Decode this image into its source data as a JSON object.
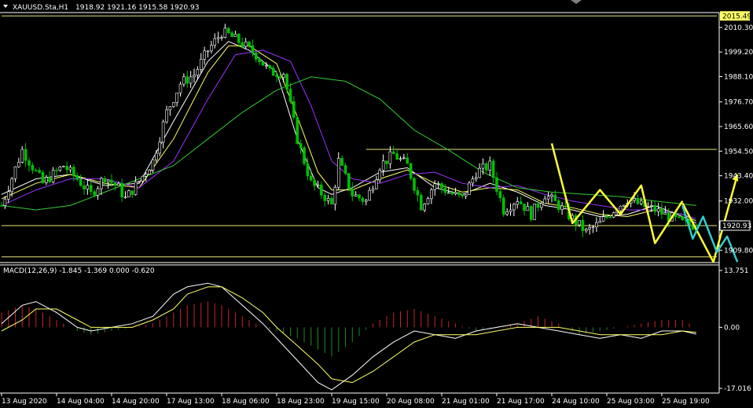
{
  "header": {
    "symbol": "XAUUSD.Sta,H1",
    "ohlc": "1918.92 1921.16 1915.58 1920.93"
  },
  "colors": {
    "background": "#000000",
    "axis": "#ffffff",
    "bull_candle": "#ffffff",
    "bear_candle": "#00c000",
    "ma_fast": "#ffffff",
    "ma_mid": "#ffff66",
    "ma_slow": "#9933ff",
    "ma_long": "#33cc33",
    "hline": "#e6e67a",
    "projection_yellow": "#ffff33",
    "projection_cyan": "#33cccc",
    "macd_hist_pos": "#cc2222",
    "macd_hist_neg": "#228822",
    "macd_line": "#ffffff",
    "signal_line": "#ffff66",
    "price_box_top_bg": "#ffff66",
    "price_box_cur_bg": "#000000"
  },
  "chart_data": {
    "type": "line",
    "symbol": "XAUUSD.Sta,H1",
    "timeframe": "H1",
    "price_axis": {
      "ylim": [
        1904.6,
        2017.0
      ],
      "ticks": [
        2010.3,
        1999.2,
        1988.1,
        1976.7,
        1965.6,
        1954.5,
        1943.4,
        1932.0,
        1909.8
      ],
      "tick_labels": [
        "2010.30",
        "1999.20",
        "1988.10",
        "1976.70",
        "1965.60",
        "1954.50",
        "1943.40",
        "1932.00",
        "1909.80"
      ]
    },
    "price_markers": [
      {
        "label": "2015.49",
        "value": 2015.49,
        "style": "top-line"
      },
      {
        "label": "1920.93",
        "value": 1920.93,
        "style": "current"
      }
    ],
    "horizontal_lines": [
      2015.49,
      1955.3,
      1920.93,
      1906.8
    ],
    "time_axis": {
      "x_range": [
        0,
        208
      ],
      "tick_x": [
        0,
        16,
        32,
        48,
        64,
        80,
        96,
        112,
        128,
        144,
        160,
        176,
        192
      ],
      "tick_labels": [
        "13 Aug 2020",
        "14 Aug 04:00",
        "14 Aug 20:00",
        "17 Aug 13:00",
        "18 Aug 06:00",
        "18 Aug 23:00",
        "19 Aug 15:00",
        "20 Aug 08:00",
        "21 Aug 01:00",
        "21 Aug 17:00",
        "24 Aug 10:00",
        "25 Aug 03:00",
        "25 Aug 19:00"
      ]
    },
    "close_path": {
      "x": [
        0,
        6,
        12,
        18,
        22,
        26,
        30,
        34,
        36,
        40,
        44,
        48,
        52,
        56,
        60,
        64,
        66,
        70,
        74,
        78,
        82,
        86,
        90,
        94,
        96,
        98,
        102,
        106,
        110,
        114,
        118,
        122,
        126,
        130,
        134,
        138,
        142,
        146,
        150,
        154,
        158,
        162,
        166,
        170,
        174,
        178,
        182,
        186,
        190,
        194,
        198,
        202
      ],
      "y": [
        1930,
        1955,
        1940,
        1948,
        1942,
        1935,
        1943,
        1938,
        1933,
        1941,
        1950,
        1972,
        1985,
        1989,
        2000,
        2008,
        2007,
        2003,
        1998,
        1990,
        1990,
        1960,
        1940,
        1934,
        1930,
        1950,
        1935,
        1932,
        1948,
        1953,
        1948,
        1930,
        1940,
        1936,
        1933,
        1945,
        1948,
        1928,
        1933,
        1926,
        1935,
        1930,
        1924,
        1918,
        1922,
        1928,
        1933,
        1930,
        1928,
        1925,
        1922,
        1920.93
      ]
    },
    "moving_averages": [
      {
        "x": [
          0,
          10,
          20,
          30,
          40,
          50,
          60,
          66,
          72,
          80,
          86,
          92,
          96,
          102,
          110,
          118,
          126,
          134,
          142,
          150,
          158,
          166,
          174,
          182,
          190,
          198,
          202
        ],
        "y": [
          1935,
          1942,
          1944,
          1939,
          1940,
          1968,
          1995,
          2004,
          2000,
          1990,
          1960,
          1938,
          1935,
          1938,
          1945,
          1947,
          1938,
          1935,
          1940,
          1936,
          1930,
          1928,
          1925,
          1926,
          1930,
          1925,
          1922
        ]
      },
      {
        "x": [
          0,
          10,
          20,
          30,
          40,
          50,
          60,
          66,
          72,
          80,
          86,
          92,
          96,
          102,
          110,
          118,
          126,
          134,
          142,
          150,
          158,
          166,
          174,
          182,
          190,
          198,
          202
        ],
        "y": [
          1933,
          1940,
          1944,
          1940,
          1938,
          1960,
          1990,
          2002,
          2002,
          1994,
          1970,
          1945,
          1937,
          1937,
          1942,
          1946,
          1940,
          1936,
          1938,
          1937,
          1931,
          1929,
          1926,
          1925,
          1928,
          1926,
          1923
        ]
      },
      {
        "x": [
          0,
          10,
          20,
          30,
          40,
          50,
          60,
          68,
          76,
          84,
          90,
          96,
          102,
          110,
          118,
          126,
          134,
          142,
          150,
          158,
          166,
          174,
          182,
          190,
          198,
          202
        ],
        "y": [
          1930,
          1937,
          1942,
          1942,
          1938,
          1950,
          1978,
          1998,
          2000,
          1995,
          1975,
          1950,
          1942,
          1940,
          1944,
          1945,
          1940,
          1938,
          1939,
          1935,
          1932,
          1930,
          1928,
          1928,
          1926,
          1924
        ]
      },
      {
        "x": [
          0,
          10,
          20,
          30,
          40,
          50,
          60,
          70,
          80,
          90,
          100,
          110,
          120,
          130,
          140,
          150,
          160,
          170,
          180,
          190,
          202
        ],
        "y": [
          1930,
          1928,
          1930,
          1936,
          1942,
          1948,
          1960,
          1972,
          1982,
          1988,
          1986,
          1978,
          1964,
          1955,
          1945,
          1938,
          1936,
          1935,
          1934,
          1932,
          1930
        ]
      }
    ],
    "projections": [
      {
        "color": "yellow",
        "x": [
          160,
          166,
          174,
          180,
          186,
          190,
          198
        ],
        "y": [
          1958,
          1922,
          1937,
          1926,
          1939,
          1913,
          1932
        ]
      },
      {
        "color": "yellow",
        "x": [
          198,
          207,
          214
        ],
        "y": [
          1931,
          1904.5,
          1944
        ]
      },
      {
        "color": "cyan",
        "x": [
          198,
          201,
          204,
          208,
          211,
          214
        ],
        "y": [
          1930,
          1915,
          1925,
          1909,
          1916,
          1904.5
        ]
      }
    ],
    "macd": {
      "label": "MACD(12,26,9) -1.845 -1.369 0.000 -0.620",
      "ylim": [
        -17.016,
        13.751
      ],
      "tick_labels": [
        "13.751",
        "0.00",
        "-17.016"
      ],
      "ticks": [
        13.751,
        0.0,
        -17.016
      ],
      "histogram": {
        "x": [
          0,
          6,
          10,
          16,
          22,
          26,
          32,
          38,
          44,
          50,
          54,
          60,
          64,
          70,
          76,
          80,
          86,
          92,
          96,
          102,
          108,
          114,
          120,
          126,
          132,
          138,
          144,
          150,
          156,
          162,
          168,
          174,
          180,
          186,
          192,
          198,
          202
        ],
        "v": [
          4,
          6,
          5,
          2,
          -1,
          -2,
          -1,
          0,
          1,
          4,
          6,
          7,
          6,
          3,
          0,
          -1,
          -3,
          -6,
          -8,
          -4,
          1,
          4,
          5,
          3,
          1,
          -1,
          0,
          1,
          3,
          1,
          -2,
          -1,
          0,
          1,
          2,
          2,
          0
        ]
      },
      "macd_line": {
        "x": [
          0,
          6,
          10,
          16,
          22,
          26,
          32,
          38,
          44,
          50,
          54,
          60,
          64,
          70,
          76,
          80,
          86,
          92,
          96,
          102,
          108,
          114,
          120,
          126,
          132,
          138,
          144,
          150,
          156,
          162,
          168,
          174,
          180,
          186,
          192,
          198,
          202
        ],
        "v": [
          1,
          6,
          7,
          4,
          0,
          -1,
          0,
          1,
          3,
          9,
          11,
          12,
          11,
          6,
          1,
          -3,
          -9,
          -15,
          -17,
          -13,
          -8,
          -4,
          -1,
          -2,
          -3,
          -1,
          0,
          1,
          0,
          -1,
          -2,
          -3,
          -2,
          -3,
          -1,
          -1,
          -1.845
        ]
      },
      "signal_line": {
        "x": [
          0,
          6,
          10,
          16,
          22,
          26,
          32,
          38,
          44,
          50,
          54,
          60,
          64,
          70,
          76,
          80,
          86,
          92,
          96,
          102,
          108,
          114,
          120,
          126,
          132,
          138,
          144,
          150,
          156,
          162,
          168,
          174,
          180,
          186,
          192,
          198,
          202
        ],
        "v": [
          -1,
          2,
          5,
          5,
          2,
          0,
          0,
          0,
          2,
          5,
          9,
          11,
          11,
          8,
          4,
          0,
          -5,
          -10,
          -14,
          -15,
          -12,
          -8,
          -4,
          -2,
          -2,
          -2,
          -1,
          0,
          0,
          0,
          -1,
          -2,
          -2,
          -2,
          -2,
          -1,
          -1.369
        ]
      }
    }
  }
}
